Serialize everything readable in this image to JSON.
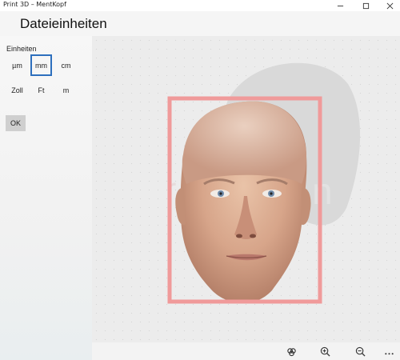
{
  "window": {
    "title": "Print 3D – MentKopf",
    "minimize_icon": "minimize-icon",
    "maximize_icon": "maximize-icon",
    "close_icon": "close-icon"
  },
  "header": {
    "title": "Dateieinheiten"
  },
  "units": {
    "label": "Einheiten",
    "options": [
      {
        "label": "µm",
        "selected": false
      },
      {
        "label": "mm",
        "selected": true
      },
      {
        "label": "cm",
        "selected": false
      },
      {
        "label": "Zoll",
        "selected": false
      },
      {
        "label": "Ft",
        "selected": false
      },
      {
        "label": "m",
        "selected": false
      }
    ],
    "ok_label": "OK"
  },
  "viewport": {
    "bounding_box_color": "#f09a9a",
    "accent_color": "#2d6fbd"
  },
  "toolbar": {
    "tools": [
      "view-3d-icon",
      "zoom-in-icon",
      "zoom-out-icon",
      "more-icon"
    ]
  }
}
